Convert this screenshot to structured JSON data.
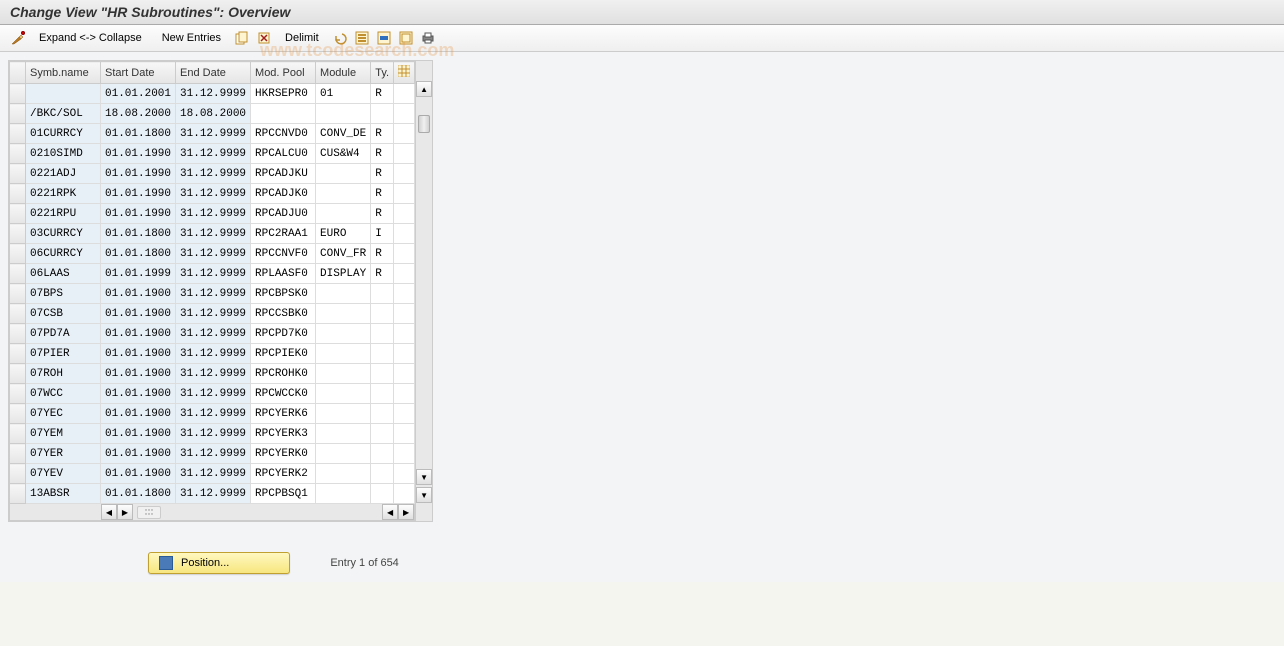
{
  "title": "Change View \"HR Subroutines\": Overview",
  "toolbar": {
    "expand_collapse": "Expand <-> Collapse",
    "new_entries": "New Entries",
    "delimit": "Delimit"
  },
  "columns": {
    "symb": "Symb.name",
    "start": "Start Date",
    "end": "End Date",
    "modpool": "Mod. Pool",
    "module": "Module",
    "ty": "Ty."
  },
  "rows": [
    {
      "symb": "",
      "start": "01.01.2001",
      "end": "31.12.9999",
      "modpool": "HKRSEPR0",
      "module": "01",
      "ty": "R",
      "hl_start": true
    },
    {
      "symb": "/BKC/SOL",
      "start": "18.08.2000",
      "end": "18.08.2000",
      "modpool": "",
      "module": "",
      "ty": ""
    },
    {
      "symb": "01CURRCY",
      "start": "01.01.1800",
      "end": "31.12.9999",
      "modpool": "RPCCNVD0",
      "module": "CONV_DE",
      "ty": "R"
    },
    {
      "symb": "0210SIMD",
      "start": "01.01.1990",
      "end": "31.12.9999",
      "modpool": "RPCALCU0",
      "module": "CUS&W4",
      "ty": "R"
    },
    {
      "symb": "0221ADJ",
      "start": "01.01.1990",
      "end": "31.12.9999",
      "modpool": "RPCADJKU",
      "module": "",
      "ty": "R"
    },
    {
      "symb": "0221RPK",
      "start": "01.01.1990",
      "end": "31.12.9999",
      "modpool": "RPCADJK0",
      "module": "",
      "ty": "R"
    },
    {
      "symb": "0221RPU",
      "start": "01.01.1990",
      "end": "31.12.9999",
      "modpool": "RPCADJU0",
      "module": "",
      "ty": "R"
    },
    {
      "symb": "03CURRCY",
      "start": "01.01.1800",
      "end": "31.12.9999",
      "modpool": "RPC2RAA1",
      "module": "EURO",
      "ty": "I"
    },
    {
      "symb": "06CURRCY",
      "start": "01.01.1800",
      "end": "31.12.9999",
      "modpool": "RPCCNVF0",
      "module": "CONV_FR",
      "ty": "R"
    },
    {
      "symb": "06LAAS",
      "start": "01.01.1999",
      "end": "31.12.9999",
      "modpool": "RPLAASF0",
      "module": "DISPLAY",
      "ty": "R"
    },
    {
      "symb": "07BPS",
      "start": "01.01.1900",
      "end": "31.12.9999",
      "modpool": "RPCBPSK0",
      "module": "",
      "ty": ""
    },
    {
      "symb": "07CSB",
      "start": "01.01.1900",
      "end": "31.12.9999",
      "modpool": "RPCCSBK0",
      "module": "",
      "ty": ""
    },
    {
      "symb": "07PD7A",
      "start": "01.01.1900",
      "end": "31.12.9999",
      "modpool": "RPCPD7K0",
      "module": "",
      "ty": ""
    },
    {
      "symb": "07PIER",
      "start": "01.01.1900",
      "end": "31.12.9999",
      "modpool": "RPCPIEK0",
      "module": "",
      "ty": ""
    },
    {
      "symb": "07ROH",
      "start": "01.01.1900",
      "end": "31.12.9999",
      "modpool": "RPCROHK0",
      "module": "",
      "ty": ""
    },
    {
      "symb": "07WCC",
      "start": "01.01.1900",
      "end": "31.12.9999",
      "modpool": "RPCWCCK0",
      "module": "",
      "ty": ""
    },
    {
      "symb": "07YEC",
      "start": "01.01.1900",
      "end": "31.12.9999",
      "modpool": "RPCYERK6",
      "module": "",
      "ty": ""
    },
    {
      "symb": "07YEM",
      "start": "01.01.1900",
      "end": "31.12.9999",
      "modpool": "RPCYERK3",
      "module": "",
      "ty": ""
    },
    {
      "symb": "07YER",
      "start": "01.01.1900",
      "end": "31.12.9999",
      "modpool": "RPCYERK0",
      "module": "",
      "ty": ""
    },
    {
      "symb": "07YEV",
      "start": "01.01.1900",
      "end": "31.12.9999",
      "modpool": "RPCYERK2",
      "module": "",
      "ty": ""
    },
    {
      "symb": "13ABSR",
      "start": "01.01.1800",
      "end": "31.12.9999",
      "modpool": "RPCPBSQ1",
      "module": "",
      "ty": ""
    }
  ],
  "footer": {
    "position_label": "Position...",
    "entry_label": "Entry 1 of 654"
  },
  "watermark": "www.tcodesearch.com"
}
